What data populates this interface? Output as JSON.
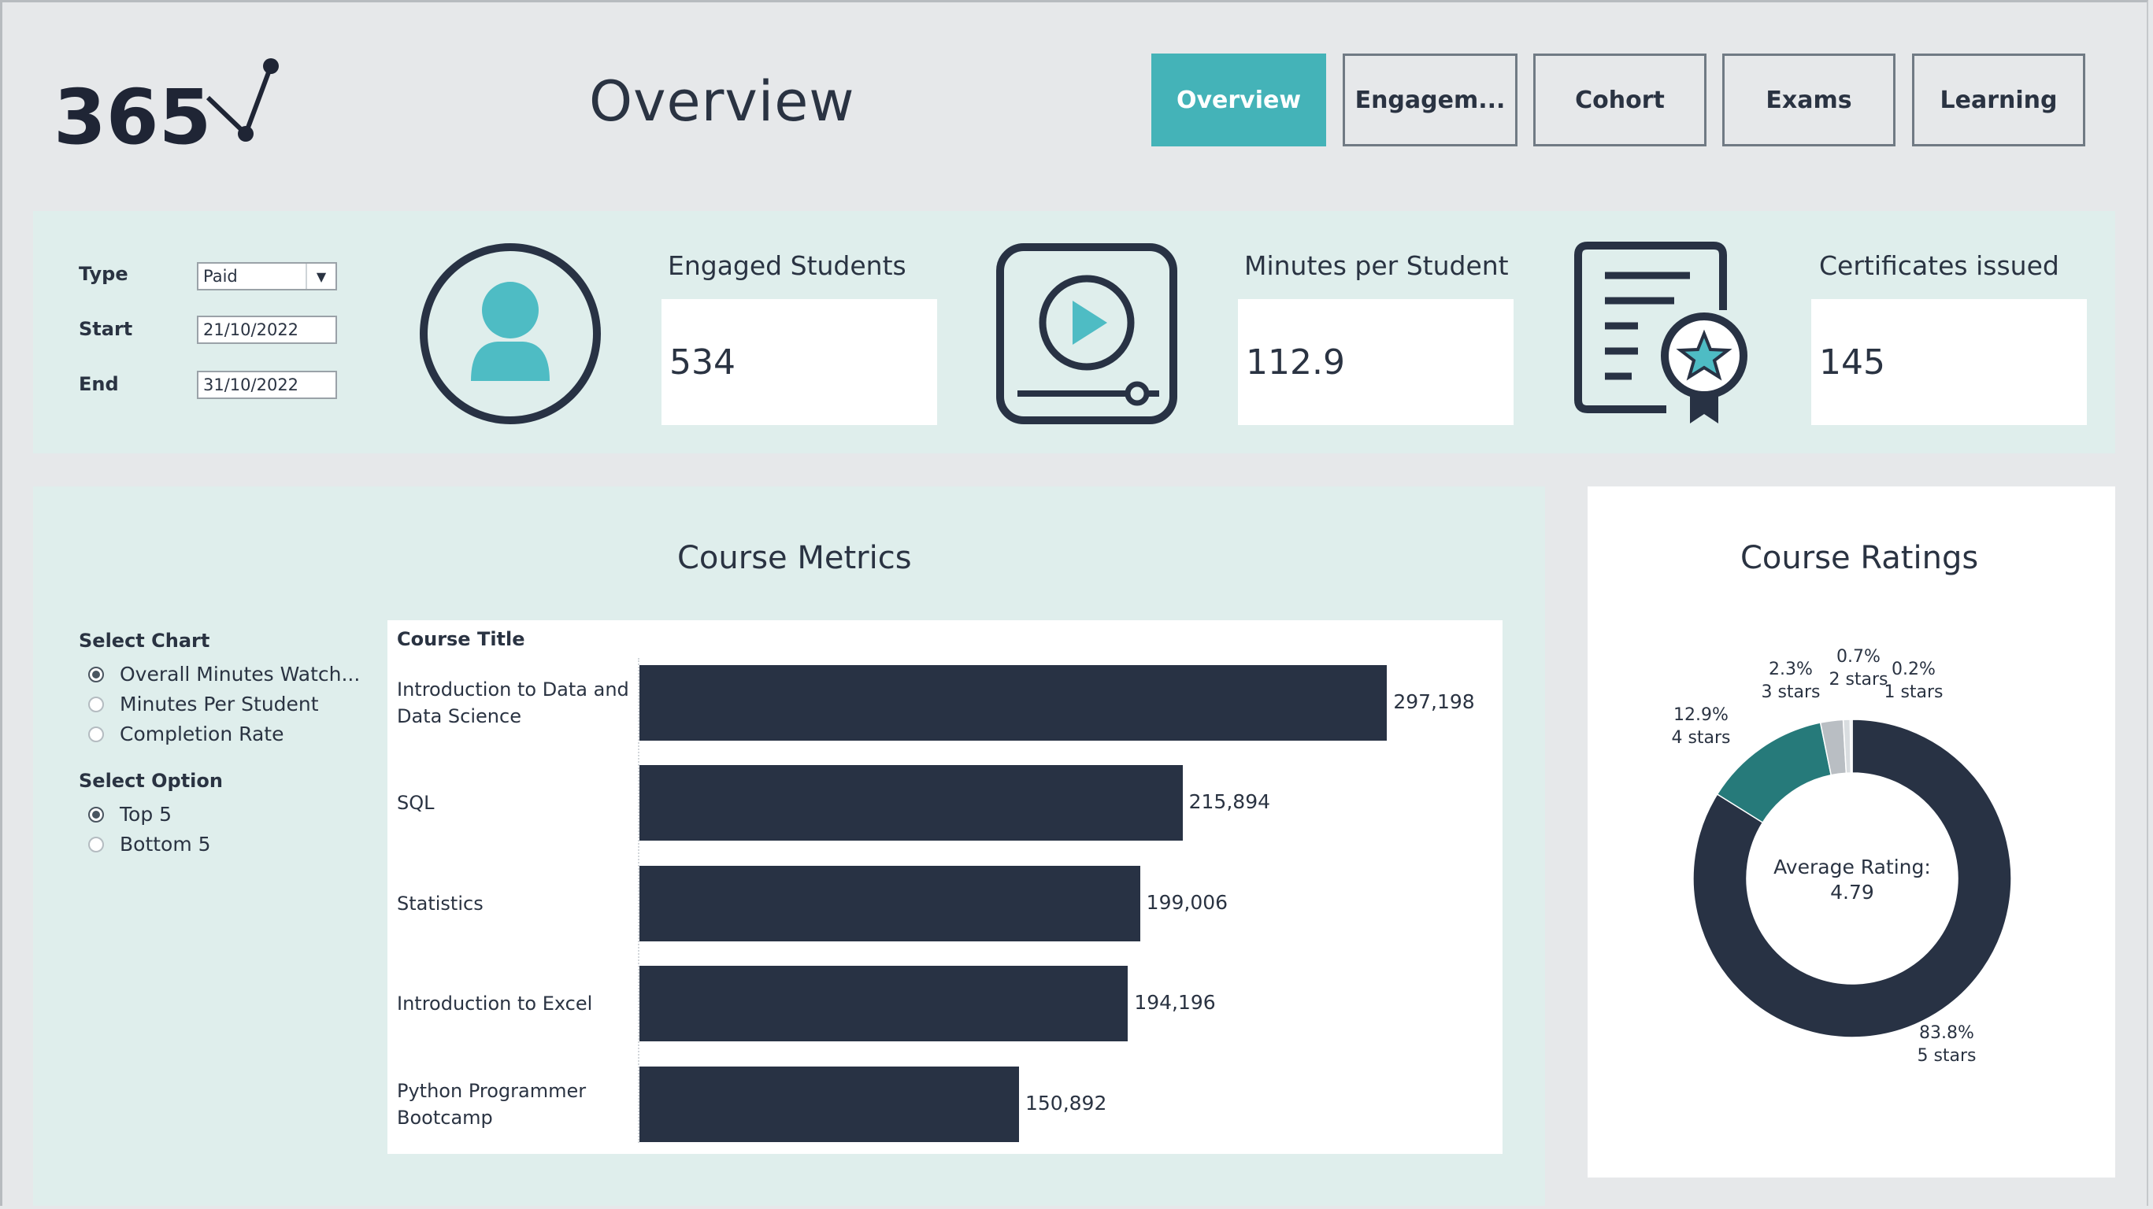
{
  "header": {
    "logo_text": "365",
    "title": "Overview",
    "nav": [
      {
        "label": "Overview",
        "active": true
      },
      {
        "label": "Engagem...",
        "active": false
      },
      {
        "label": "Cohort",
        "active": false
      },
      {
        "label": "Exams",
        "active": false
      },
      {
        "label": "Learning",
        "active": false
      }
    ]
  },
  "filters": {
    "type_label": "Type",
    "type_value": "Paid",
    "start_label": "Start",
    "start_value": "21/10/2022",
    "end_label": "End",
    "end_value": "31/10/2022"
  },
  "kpis": [
    {
      "title": "Engaged Students",
      "value": "534",
      "icon": "user-icon"
    },
    {
      "title": "Minutes per Student",
      "value": "112.9",
      "icon": "video-player-icon"
    },
    {
      "title": "Certificates issued",
      "value": "145",
      "icon": "certificate-icon"
    }
  ],
  "metrics": {
    "title": "Course Metrics",
    "select_chart_label": "Select Chart",
    "chart_options": [
      {
        "label": "Overall Minutes Watch...",
        "selected": true
      },
      {
        "label": "Minutes Per Student",
        "selected": false
      },
      {
        "label": "Completion Rate",
        "selected": false
      }
    ],
    "select_option_label": "Select Option",
    "options": [
      {
        "label": "Top 5",
        "selected": true
      },
      {
        "label": "Bottom 5",
        "selected": false
      }
    ],
    "column_header": "Course Title"
  },
  "ratings": {
    "title": "Course Ratings",
    "center_line1": "Average Rating:",
    "center_line2": "4.79"
  },
  "colors": {
    "accent": "#44b3b8",
    "dark": "#283244",
    "teal_dark": "#267a7a",
    "grey": "#b9bec3",
    "panel_bg": "#dfeeec"
  },
  "chart_data": [
    {
      "type": "bar",
      "orientation": "horizontal",
      "title": "Course Metrics",
      "xlabel": "",
      "ylabel": "Course Title",
      "categories": [
        "Introduction to Data and Data Science",
        "SQL",
        "Statistics",
        "Introduction to Excel",
        "Python Programmer Bootcamp"
      ],
      "values": [
        297198,
        215894,
        199006,
        194196,
        150892
      ],
      "value_labels": [
        "297,198",
        "215,894",
        "199,006",
        "194,196",
        "150,892"
      ],
      "xlim": [
        0,
        350000
      ],
      "grid": false
    },
    {
      "type": "pie",
      "donut": true,
      "title": "Course Ratings",
      "categories": [
        "5 stars",
        "4 stars",
        "3 stars",
        "2 stars",
        "1 stars"
      ],
      "values": [
        83.8,
        12.9,
        2.3,
        0.7,
        0.2
      ],
      "value_labels": [
        "83.8%",
        "12.9%",
        "2.3%",
        "0.7%",
        "0.2%"
      ],
      "colors": [
        "#283244",
        "#267a7a",
        "#b9bec3",
        "#d9dde0",
        "#e9ecee"
      ]
    }
  ]
}
